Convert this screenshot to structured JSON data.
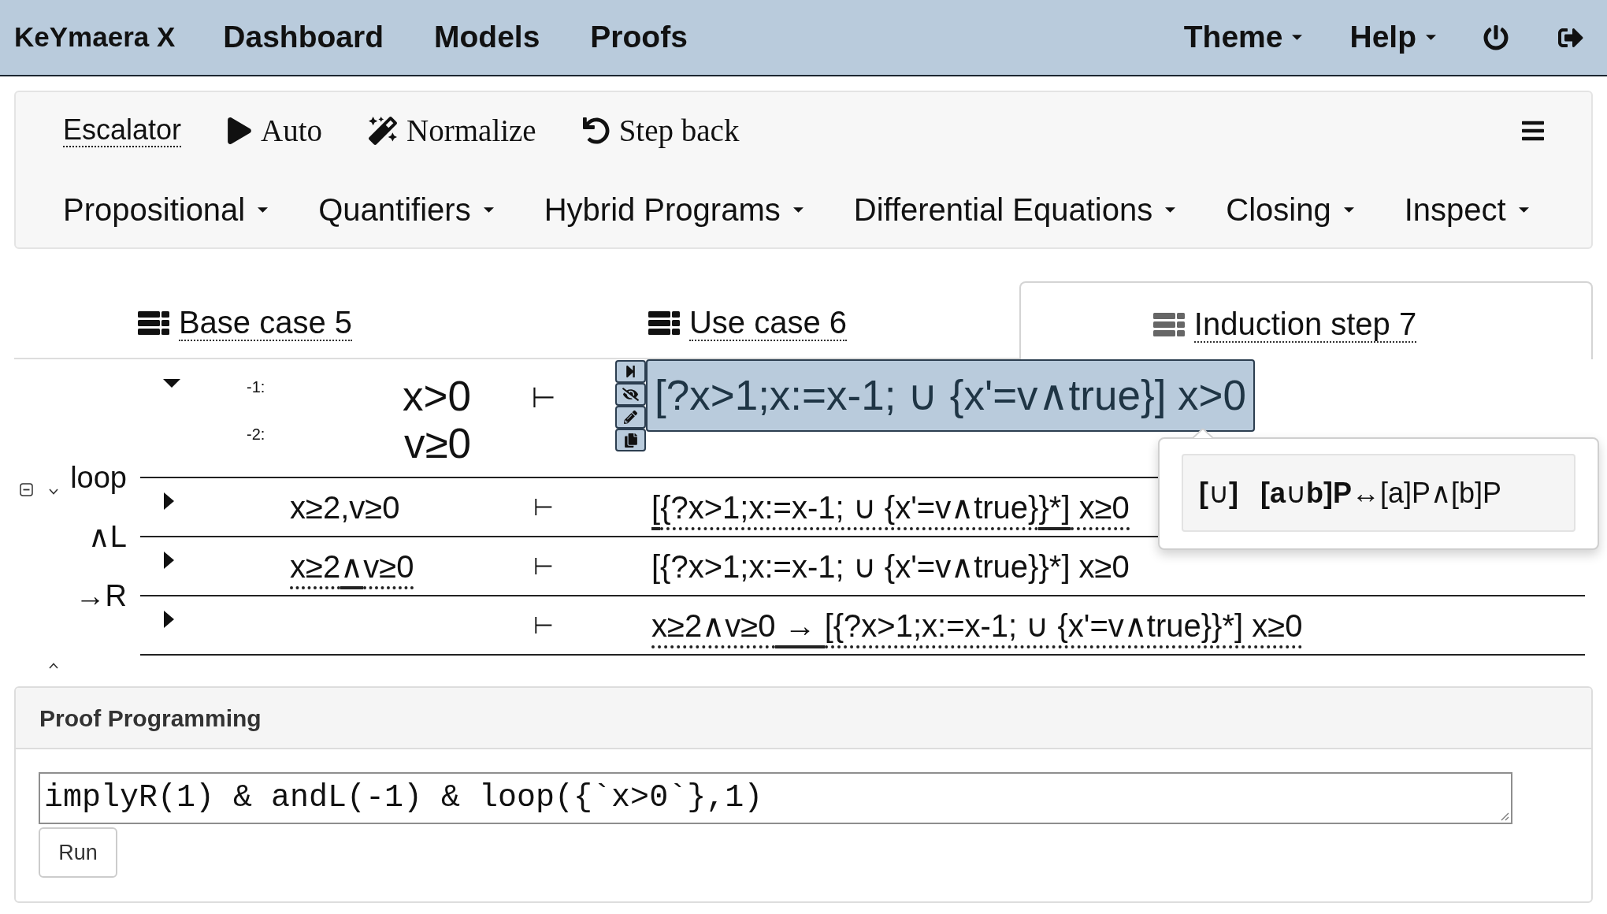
{
  "navbar": {
    "brand": "KeYmaera X",
    "links": [
      {
        "label": "Dashboard"
      },
      {
        "label": "Models"
      },
      {
        "label": "Proofs"
      }
    ],
    "menus": [
      {
        "label": "Theme"
      },
      {
        "label": "Help"
      }
    ]
  },
  "toolbar": {
    "actions": [
      {
        "label": "Escalator",
        "kind": "menu"
      },
      {
        "label": "Auto",
        "kind": "button"
      },
      {
        "label": "Normalize",
        "kind": "button"
      },
      {
        "label": "Step back",
        "kind": "button"
      }
    ],
    "menus": [
      {
        "label": "Propositional"
      },
      {
        "label": "Quantifiers"
      },
      {
        "label": "Hybrid Programs"
      },
      {
        "label": "Differential Equations"
      },
      {
        "label": "Closing"
      },
      {
        "label": "Inspect"
      }
    ]
  },
  "tabs": [
    {
      "label": "Base case 5",
      "selected": false
    },
    {
      "label": "Use case 6",
      "selected": false
    },
    {
      "label": "Induction step 7",
      "selected": true
    }
  ],
  "goal": {
    "expanded": true,
    "antecedent": [
      {
        "index": "-1:",
        "formula": "x>0"
      },
      {
        "index": "-2:",
        "formula": "v≥0"
      }
    ],
    "turnstile": "⊢",
    "succedent": [
      {
        "formula": "[?x>1;x:=x-1; ∪ {x'=v∧true}] x>0",
        "highlighted": true
      }
    ]
  },
  "tooltip": {
    "rule": "**[**∪**]**",
    "axiom": "**[a**∪**b]P**↔[a]P∧[b]P"
  },
  "steps": [
    {
      "rule": "loop",
      "expanded": false,
      "antecedent": [
        {
          "text": "x≥2,v≥0",
          "kind": "plain"
        }
      ],
      "turnstile": "⊢",
      "succedent": [
        {
          "text": "[",
          "kind": "solid"
        },
        {
          "text": "{?x>1;x:=x-1; ∪ {x'=v∧true}",
          "kind": "dotted"
        },
        {
          "text": "}*]",
          "kind": "solid"
        },
        {
          "text": " x≥0",
          "kind": "dotted"
        }
      ]
    },
    {
      "rule": "∧L",
      "expanded": false,
      "antecedent": [
        {
          "text": "x≥2",
          "kind": "dotted"
        },
        {
          "text": "∧",
          "kind": "solid"
        },
        {
          "text": "v≥0",
          "kind": "dotted"
        }
      ],
      "turnstile": "⊢",
      "succedent": [
        {
          "text": "[{?x>1;x:=x-1; ∪ {x'=v∧true}}*] x≥0",
          "kind": "plain"
        }
      ]
    },
    {
      "rule": "→R",
      "expanded": false,
      "turnstile": "⊢",
      "succedent": [
        {
          "text": "x≥2∧v≥0",
          "kind": "dotted"
        },
        {
          "text": " → ",
          "kind": "solid"
        },
        {
          "text": "[{?x>1;x:=x-1; ∪ {x'=v∧true}}*] x≥0",
          "kind": "dotted"
        }
      ]
    }
  ],
  "proof_programming": {
    "title": "Proof Programming",
    "script": "implyR(1) & andL(-1) & loop({`x>0`},1)",
    "run_button": "Run"
  }
}
